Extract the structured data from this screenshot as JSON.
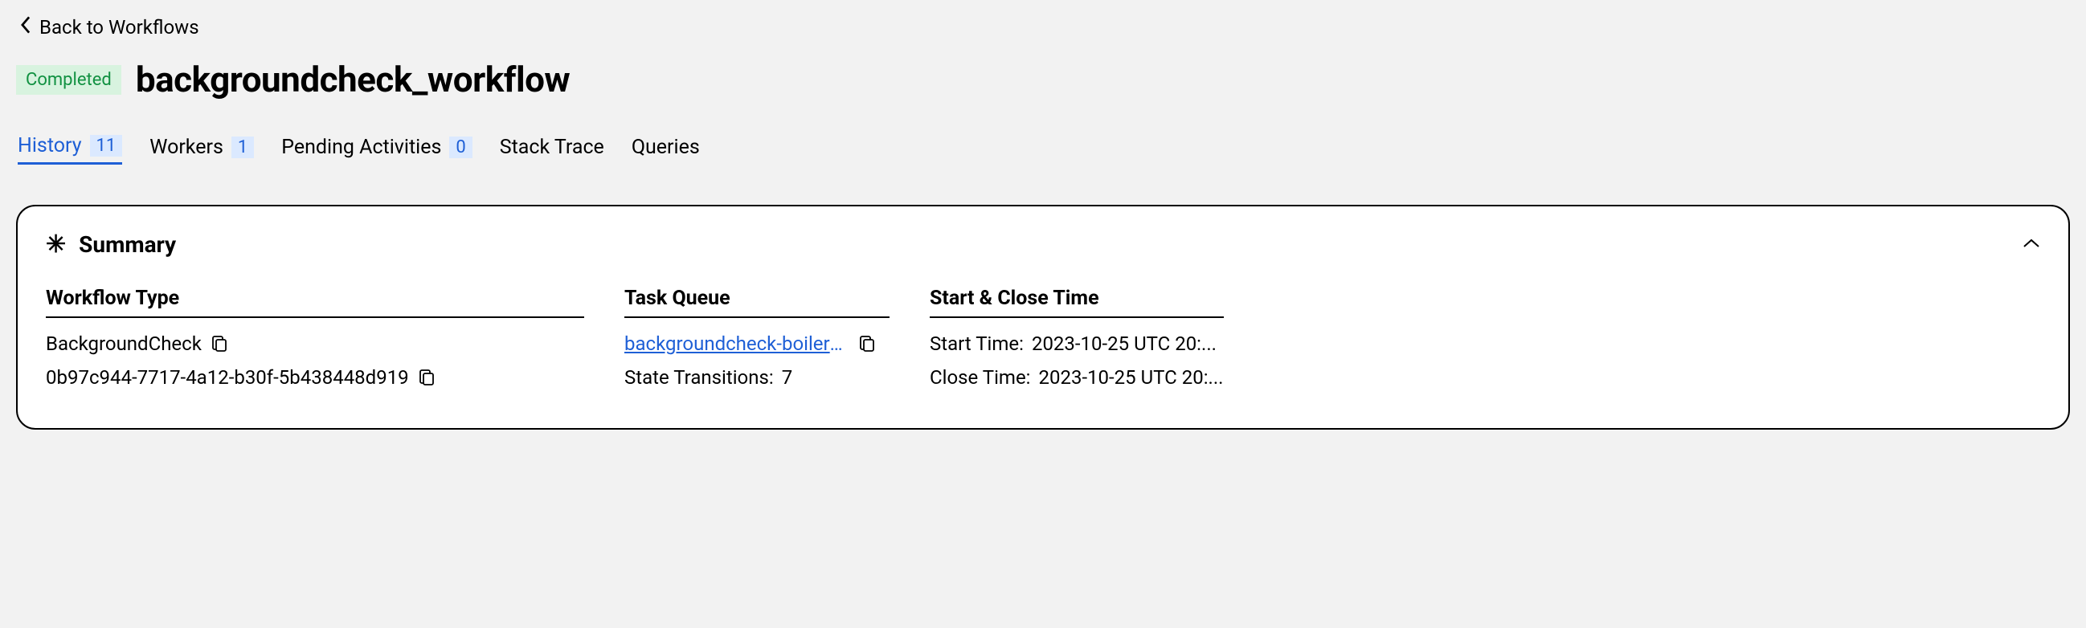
{
  "back_link": "Back to Workflows",
  "status": "Completed",
  "workflow_title": "backgroundcheck_workflow",
  "tabs": [
    {
      "label": "History",
      "count": "11",
      "active": true
    },
    {
      "label": "Workers",
      "count": "1",
      "active": false
    },
    {
      "label": "Pending Activities",
      "count": "0",
      "active": false
    },
    {
      "label": "Stack Trace",
      "count": null,
      "active": false
    },
    {
      "label": "Queries",
      "count": null,
      "active": false
    }
  ],
  "summary": {
    "title": "Summary",
    "columns": {
      "workflow_type": {
        "header": "Workflow Type",
        "type_name": "BackgroundCheck",
        "workflow_id": "0b97c944-7717-4a12-b30f-5b438448d919"
      },
      "task_queue": {
        "header": "Task Queue",
        "queue_name": "backgroundcheck-boilerplate-...",
        "state_transitions_label": "State Transitions:",
        "state_transitions_value": "7"
      },
      "times": {
        "header": "Start & Close Time",
        "start_label": "Start Time:",
        "start_value": "2023-10-25 UTC 20:...",
        "close_label": "Close Time:",
        "close_value": "2023-10-25 UTC 20:..."
      }
    }
  }
}
